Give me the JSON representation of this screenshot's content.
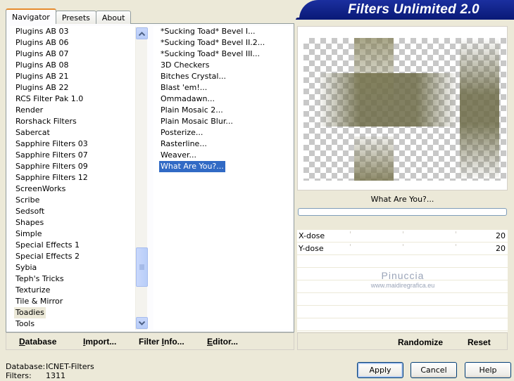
{
  "banner": {
    "title": "Filters Unlimited 2.0"
  },
  "tabs": [
    {
      "label": "Navigator",
      "active": true
    },
    {
      "label": "Presets",
      "active": false
    },
    {
      "label": "About",
      "active": false
    }
  ],
  "categories": [
    "Plugins AB 03",
    "Plugins AB 06",
    "Plugins AB 07",
    "Plugins AB 08",
    "Plugins AB 21",
    "Plugins AB 22",
    "RCS Filter Pak 1.0",
    "Render",
    "Rorshack Filters",
    "Sabercat",
    "Sapphire Filters 03",
    "Sapphire Filters 07",
    "Sapphire Filters 09",
    "Sapphire Filters 12",
    "ScreenWorks",
    "Scribe",
    "Sedsoft",
    "Shapes",
    "Simple",
    "Special Effects 1",
    "Special Effects 2",
    "Sybia",
    "Teph's Tricks",
    "Texturize",
    "Tile & Mirror",
    "Toadies",
    "Tools"
  ],
  "selected_category": "Toadies",
  "filters": [
    "*Sucking Toad*  Bevel I...",
    "*Sucking Toad*  Bevel II.2...",
    "*Sucking Toad*  Bevel III...",
    "3D Checkers",
    "Bitches Crystal...",
    "Blast 'em!...",
    "Ommadawn...",
    "Plain Mosaic 2...",
    "Plain Mosaic Blur...",
    "Posterize...",
    "Rasterline...",
    "Weaver...",
    "What Are You?..."
  ],
  "selected_filter": "What Are You?...",
  "left_buttons": {
    "database": {
      "pre": "",
      "u": "D",
      "post": "atabase"
    },
    "import": {
      "pre": "",
      "u": "I",
      "post": "mport..."
    },
    "filter_info": {
      "pre": "Filter ",
      "u": "I",
      "post": "nfo..."
    },
    "editor": {
      "pre": "",
      "u": "E",
      "post": "ditor..."
    }
  },
  "preview": {
    "filter_name": "What Are You?...",
    "progress": 0
  },
  "params": [
    {
      "label": "X-dose",
      "value": "20"
    },
    {
      "label": "Y-dose",
      "value": "20"
    }
  ],
  "watermark": {
    "name": "Pinuccia",
    "site": "www.maidiregrafica.eu"
  },
  "right_buttons": {
    "randomize": "Randomize",
    "reset": "Reset"
  },
  "status": {
    "database_label": "Database:",
    "database_value": "ICNET-Filters",
    "filters_label": "Filters:",
    "filters_value": "1311"
  },
  "dialog_buttons": {
    "apply": "Apply",
    "cancel": "Cancel",
    "help": "Help"
  },
  "colors": {
    "banner": "#0a1a78",
    "selection": "#316ac5",
    "preview_tone": "#6c6a46"
  }
}
